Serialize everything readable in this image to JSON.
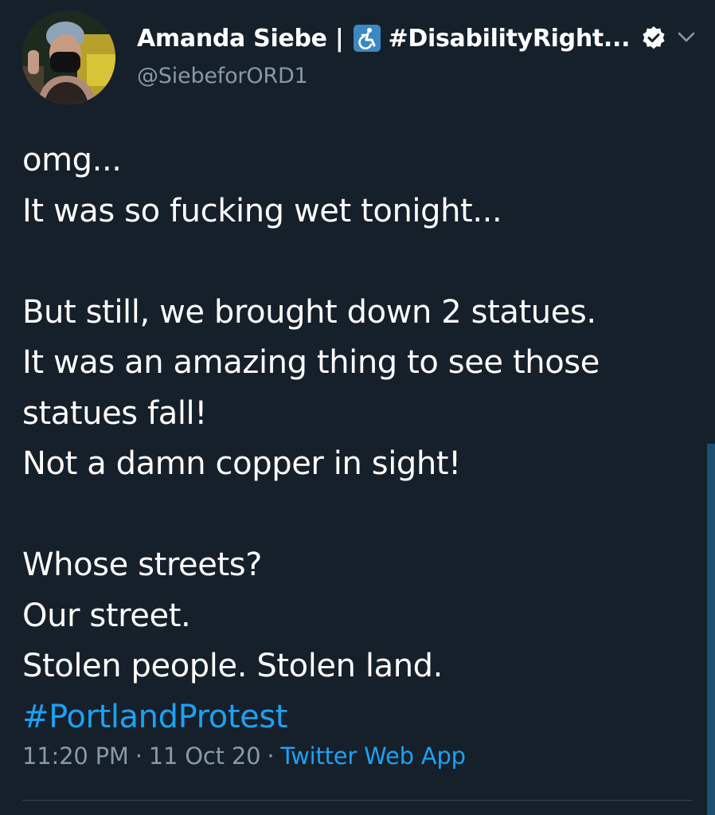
{
  "author": {
    "display_name": "Amanda Siebe | ",
    "display_name_suffix": "#DisabilityRight...",
    "handle": "@SiebeforORD1",
    "verified": true
  },
  "tweet": {
    "lines": [
      "omg...",
      "It was so fucking wet tonight...",
      "",
      "But still, we brought down 2 statues.",
      "It was an amazing thing to see those",
      "statues fall!",
      "Not a damn copper in sight!",
      "",
      "Whose streets?",
      "Our street.",
      "Stolen people. Stolen land."
    ],
    "hashtag": "#PortlandProtest"
  },
  "meta": {
    "time": "11:20 PM",
    "separator": "·",
    "date": "11 Oct 20",
    "source": "Twitter Web App"
  },
  "icons": {
    "accessibility": "accessibility-icon",
    "verified": "verified-badge-icon",
    "menu": "chevron-down-icon"
  },
  "colors": {
    "background": "#15202b",
    "text": "#ffffff",
    "secondary": "#8899a6",
    "link": "#1da1f2",
    "accessibility_badge": "#3b88c3"
  }
}
